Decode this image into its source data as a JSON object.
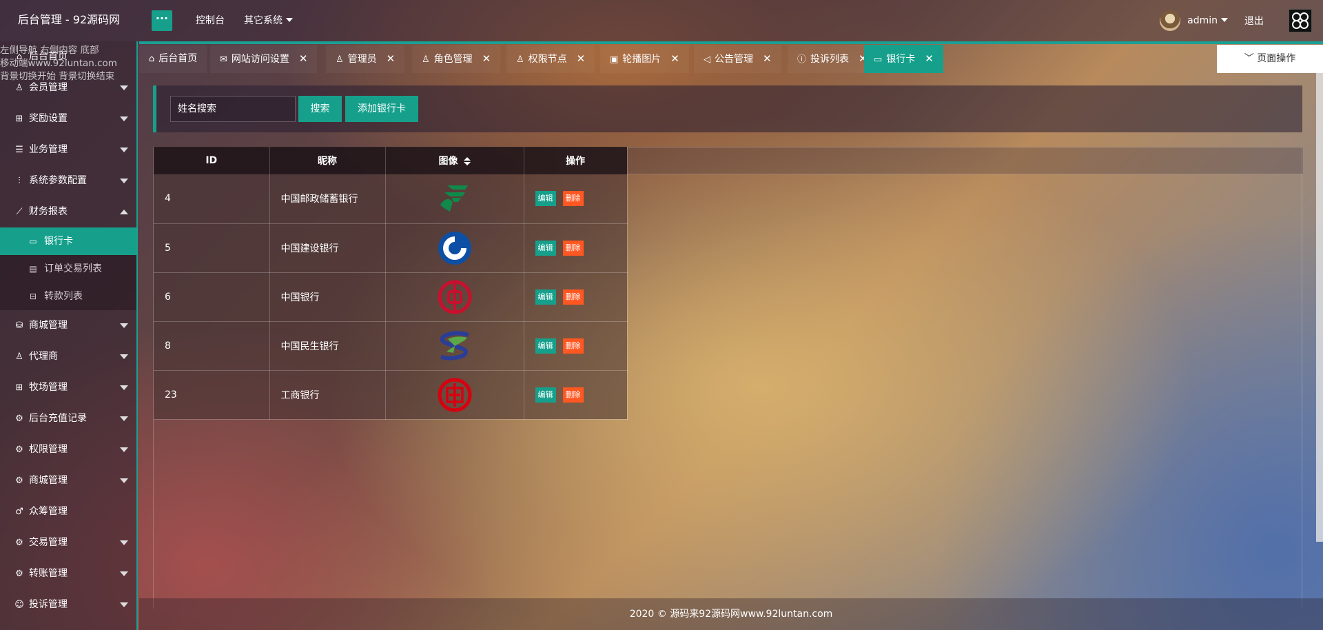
{
  "header": {
    "title": "后台管理 - 92源码网",
    "flex_label": "···",
    "nav": [
      "控制台",
      "其它系统"
    ],
    "user": "admin",
    "logout": "退出"
  },
  "overlay": {
    "line1": "左侧导航 右侧内容 底部",
    "line2": "移动端www.92luntan.com",
    "line3": "背景切换开始 背景切换结束"
  },
  "sidebar": {
    "home": "后台首页",
    "items": [
      {
        "label": "会员管理",
        "icon": "user-icon"
      },
      {
        "label": "奖励设置",
        "icon": "gift-icon"
      },
      {
        "label": "业务管理",
        "icon": "list-icon"
      },
      {
        "label": "系统参数配置",
        "icon": "sliders-icon"
      },
      {
        "label": "财务报表",
        "icon": "chart-icon",
        "expanded": true
      }
    ],
    "sub_items": [
      {
        "label": "银行卡",
        "icon": "card-icon",
        "active": true
      },
      {
        "label": "订单交易列表",
        "icon": "doc-icon"
      },
      {
        "label": "转款列表",
        "icon": "transfer-icon"
      }
    ],
    "items2": [
      {
        "label": "商城管理",
        "icon": "shop-icon"
      },
      {
        "label": "代理商",
        "icon": "user-icon"
      },
      {
        "label": "牧场管理",
        "icon": "gift-icon"
      },
      {
        "label": "后台充值记录",
        "icon": "gear-icon"
      },
      {
        "label": "权限管理",
        "icon": "gear-icon"
      },
      {
        "label": "商城管理",
        "icon": "gear-icon"
      },
      {
        "label": "众筹管理",
        "icon": "group-icon",
        "no_arrow": true
      },
      {
        "label": "交易管理",
        "icon": "gear-icon"
      },
      {
        "label": "转账管理",
        "icon": "gear-icon"
      },
      {
        "label": "投诉管理",
        "icon": "smile-icon"
      }
    ]
  },
  "tabs": [
    {
      "label": "后台首页",
      "icon": "home-icon",
      "closable": false
    },
    {
      "label": "网站访问设置",
      "icon": "mail-icon",
      "closable": true
    },
    {
      "label": "管理员",
      "icon": "user-icon",
      "closable": true
    },
    {
      "label": "角色管理",
      "icon": "user-gear-icon",
      "closable": true
    },
    {
      "label": "权限节点",
      "icon": "users-icon",
      "closable": true
    },
    {
      "label": "轮播图片",
      "icon": "image-icon",
      "closable": true
    },
    {
      "label": "公告管理",
      "icon": "speaker-icon",
      "closable": true
    },
    {
      "label": "投诉列表",
      "icon": "alert-icon",
      "closable": true
    },
    {
      "label": "银行卡",
      "icon": "card-icon",
      "closable": true,
      "active": true
    }
  ],
  "page_op": "页面操作",
  "search": {
    "placeholder": "姓名搜索",
    "search_label": "搜索",
    "add_label": "添加银行卡"
  },
  "table": {
    "headers": [
      "ID",
      "昵称",
      "图像",
      "操作"
    ],
    "edit_label": "编辑",
    "delete_label": "删除",
    "rows": [
      {
        "id": "4",
        "name": "中国邮政储蓄银行",
        "logo": "postal-bank-logo"
      },
      {
        "id": "5",
        "name": "中国建设银行",
        "logo": "ccb-logo"
      },
      {
        "id": "6",
        "name": "中国银行",
        "logo": "boc-logo"
      },
      {
        "id": "8",
        "name": "中国民生银行",
        "logo": "cmbc-logo"
      },
      {
        "id": "23",
        "name": "工商银行",
        "logo": "icbc-logo"
      }
    ]
  },
  "footer": "2020 © 源码来92源码网www.92luntan.com",
  "colors": {
    "accent": "#16a08c",
    "danger": "#ff5722"
  }
}
